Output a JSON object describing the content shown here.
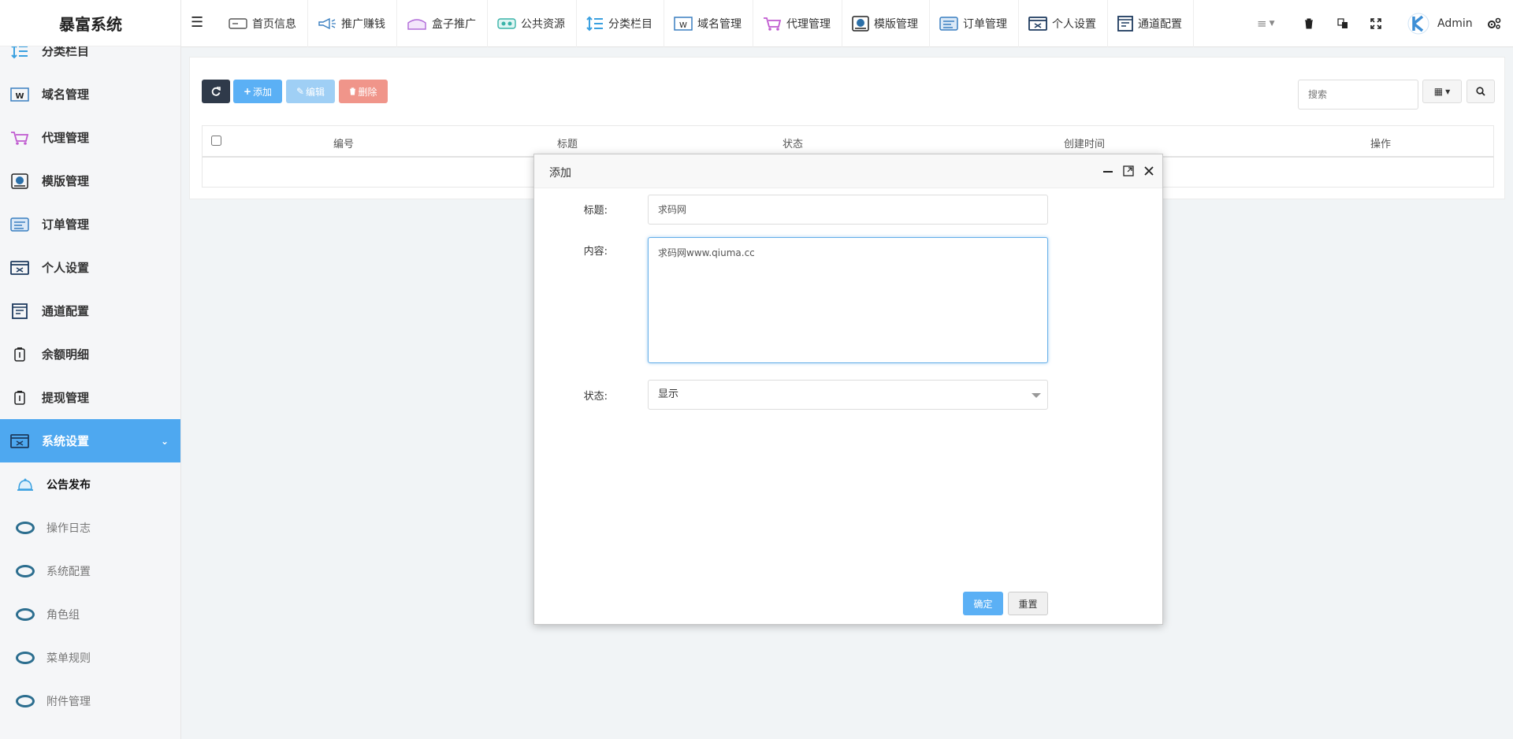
{
  "app": {
    "title": "暴富系统"
  },
  "sidebar": {
    "items": [
      {
        "label": "分类栏目",
        "icon": "category-icon"
      },
      {
        "label": "域名管理",
        "icon": "domain-icon"
      },
      {
        "label": "代理管理",
        "icon": "agent-cart-icon"
      },
      {
        "label": "模版管理",
        "icon": "template-icon"
      },
      {
        "label": "订单管理",
        "icon": "order-icon"
      },
      {
        "label": "个人设置",
        "icon": "profile-icon"
      },
      {
        "label": "通道配置",
        "icon": "channel-icon"
      },
      {
        "label": "余额明细",
        "icon": "balance-icon"
      },
      {
        "label": "提现管理",
        "icon": "withdraw-icon"
      },
      {
        "label": "系统设置",
        "icon": "system-icon",
        "active": true
      }
    ],
    "subitems": [
      {
        "label": "公告发布",
        "icon": "bell-icon",
        "current": true
      },
      {
        "label": "操作日志",
        "icon": "ring-icon"
      },
      {
        "label": "系统配置",
        "icon": "ring-icon"
      },
      {
        "label": "角色组",
        "icon": "ring-icon"
      },
      {
        "label": "菜单规则",
        "icon": "ring-icon"
      },
      {
        "label": "附件管理",
        "icon": "ring-icon"
      }
    ]
  },
  "topnav": {
    "tabs": [
      {
        "label": "首页信息",
        "icon": "home-icon"
      },
      {
        "label": "推广赚钱",
        "icon": "megaphone-icon"
      },
      {
        "label": "盒子推广",
        "icon": "box-icon"
      },
      {
        "label": "公共资源",
        "icon": "resource-icon"
      },
      {
        "label": "分类栏目",
        "icon": "category-icon"
      },
      {
        "label": "域名管理",
        "icon": "domain-icon"
      },
      {
        "label": "代理管理",
        "icon": "agent-cart-icon"
      },
      {
        "label": "模版管理",
        "icon": "template-icon"
      },
      {
        "label": "订单管理",
        "icon": "order-icon"
      },
      {
        "label": "个人设置",
        "icon": "profile-icon"
      },
      {
        "label": "通道配置",
        "icon": "channel-icon"
      }
    ],
    "user": "Admin"
  },
  "toolbar": {
    "add_label": "添加",
    "edit_label": "编辑",
    "delete_label": "删除",
    "search_placeholder": "搜索"
  },
  "table": {
    "columns": [
      "编号",
      "标题",
      "状态",
      "创建时间",
      "操作"
    ]
  },
  "modal": {
    "title": "添加",
    "fields": {
      "title_label": "标题:",
      "title_value": "求码网",
      "content_label": "内容:",
      "content_value": "求码网www.qiuma.cc",
      "status_label": "状态:",
      "status_value": "显示"
    },
    "confirm_label": "确定",
    "reset_label": "重置"
  },
  "colors": {
    "accent": "#4ea8f0",
    "dark_button": "#2f3a4a",
    "add_button": "#5bb0f5",
    "edit_button": "#9fcff5",
    "delete_button": "#f0958a"
  }
}
